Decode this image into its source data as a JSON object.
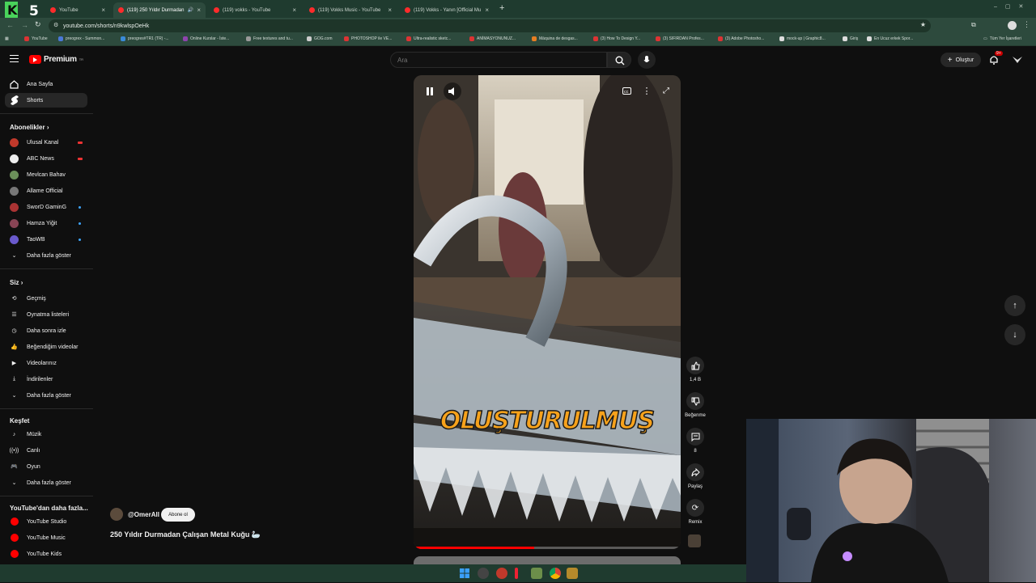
{
  "stream_logo": "K5",
  "browser": {
    "tabs": [
      {
        "label": "YouTube"
      },
      {
        "label": "(119) 250 Yıldır Durmadan"
      },
      {
        "label": "(119) vokks - YouTube"
      },
      {
        "label": "(119) Vokks Music - YouTube"
      },
      {
        "label": "(119) Vokks - Yanın [Official Mu"
      }
    ],
    "url": "youtube.com/shorts/n9kwlspOeHk",
    "bookmarks": [
      "YouTube",
      "preogrex - Summon...",
      "preogres#TR1 (TR) -...",
      "Online Kurslar - İste...",
      "Free textures and tu...",
      "GOG.com",
      "PHOTOSHOP ile VE...",
      "Ultra-realistic sketc...",
      "ANİMASYONUNUZ...",
      "Máquina de desgas...",
      "(3) How To Design Y...",
      "(3) SIFIRDAN Profes...",
      "(3) Adobe Photosho...",
      "mock-up | Graphic8...",
      "Giriş",
      "En Ucuz erkek Spor..."
    ],
    "all_bookmarks": "Tüm Yer İşaretleri"
  },
  "header": {
    "logo": "Premium",
    "logo_sup": "TR",
    "search_placeholder": "Ara",
    "create_label": "Oluştur",
    "notif_count": "9+"
  },
  "sidebar": {
    "home": "Ana Sayfa",
    "shorts": "Shorts",
    "subs_title": "Abonelikler",
    "subs": [
      {
        "name": "Ulusal Kanal",
        "color": "#c0392b",
        "badge": "live"
      },
      {
        "name": "ABC News",
        "color": "#eeeeee",
        "badge": "live"
      },
      {
        "name": "Mevlcan Bahav",
        "color": "#6b8f5a",
        "badge": ""
      },
      {
        "name": "Allame Official",
        "color": "#777777",
        "badge": ""
      },
      {
        "name": "SworD GaminG",
        "color": "#a33",
        "badge": "dot"
      },
      {
        "name": "Hamza Yiğit",
        "color": "#884455",
        "badge": "dot"
      },
      {
        "name": "TaoWB",
        "color": "#6a5acd",
        "badge": "dot"
      }
    ],
    "show_more_1": "Daha fazla göster",
    "you_title": "Siz",
    "you_items": [
      "Geçmiş",
      "Oynatma listeleri",
      "Daha sonra izle",
      "Beğendiğim videolar",
      "Videolarınız",
      "İndirilenler"
    ],
    "show_more_2": "Daha fazla göster",
    "explore_title": "Keşfet",
    "explore_items": [
      "Müzik",
      "Canlı",
      "Oyun"
    ],
    "show_more_3": "Daha fazla göster",
    "more_title": "YouTube'dan daha fazla...",
    "more_items": [
      "YouTube Studio",
      "YouTube Music",
      "YouTube Kids"
    ]
  },
  "short": {
    "caption": "OLUŞTURULMUŞ",
    "channel": "@OmerAll",
    "subscribe": "Abone ol",
    "title": "250 Yıldır Durmadan Çalışan Metal Kuğu 🦢",
    "progress": 0.45,
    "likes": "1,4 B",
    "dislike_label": "Beğenme",
    "comments": "8",
    "share_label": "Paylaş",
    "remix_label": "Remix"
  },
  "colors": {
    "brand_red": "#ff0000",
    "caption_orange": "#f7a21b"
  }
}
